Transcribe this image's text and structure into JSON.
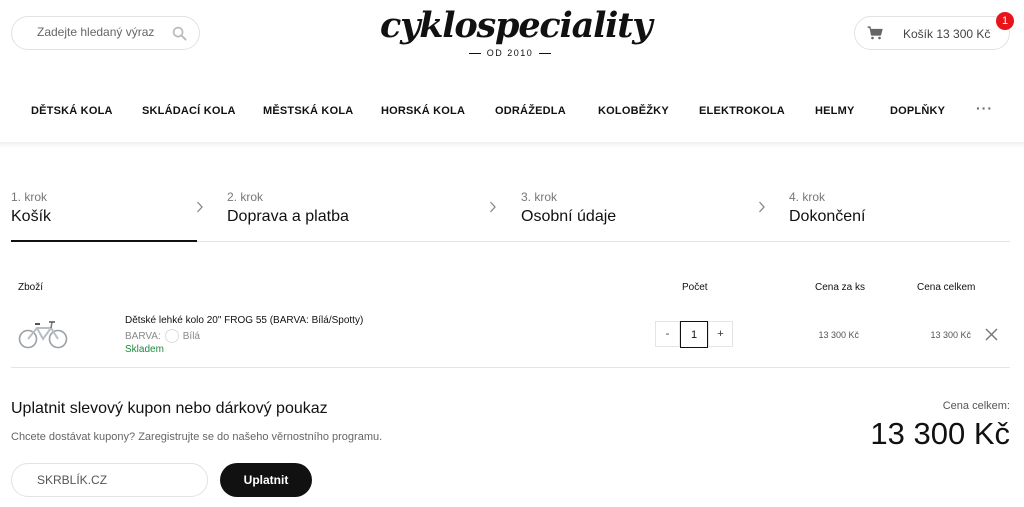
{
  "header": {
    "search_placeholder": "Zadejte hledaný výraz",
    "logo_text": "cyklospeciality",
    "logo_since": "OD 2010",
    "cart_label": "Košík 13 300 Kč",
    "cart_badge": "1"
  },
  "nav": {
    "items": [
      "DĚTSKÁ KOLA",
      "SKLÁDACÍ KOLA",
      "MĚSTSKÁ KOLA",
      "HORSKÁ KOLA",
      "ODRÁŽEDLA",
      "KOLOBĚŽKY",
      "ELEKTROKOLA",
      "HELMY",
      "DOPLŇKY"
    ],
    "more": "···"
  },
  "steps": [
    {
      "num": "1. krok",
      "title": "Košík",
      "active": true
    },
    {
      "num": "2. krok",
      "title": "Doprava a platba",
      "active": false
    },
    {
      "num": "3. krok",
      "title": "Osobní údaje",
      "active": false
    },
    {
      "num": "4. krok",
      "title": "Dokončení",
      "active": false
    }
  ],
  "table": {
    "headers": {
      "product": "Zboží",
      "qty": "Počet",
      "unit": "Cena za ks",
      "total": "Cena celkem"
    },
    "row": {
      "name": "Dětské lehké kolo 20\" FROG 55 (BARVA: Bílá/Spotty)",
      "attr_label": "BARVA:",
      "attr_value": "Bílá",
      "stock": "Skladem",
      "qty": "1",
      "minus": "-",
      "plus": "+",
      "unit_price": "13 300 Kč",
      "total_price": "13 300 Kč"
    }
  },
  "coupon": {
    "title": "Uplatnit slevový kupon nebo dárkový poukaz",
    "subtitle": "Chcete dostávat kupony? Zaregistrujte se do našeho věrnostního programu.",
    "input_value": "SKRBLÍK.CZ",
    "button": "Uplatnit"
  },
  "summary": {
    "label": "Cena celkem:",
    "value": "13 300 Kč"
  },
  "colors": {
    "accent": "#111111",
    "badge": "#e8141a",
    "stock": "#1a8c3c"
  }
}
